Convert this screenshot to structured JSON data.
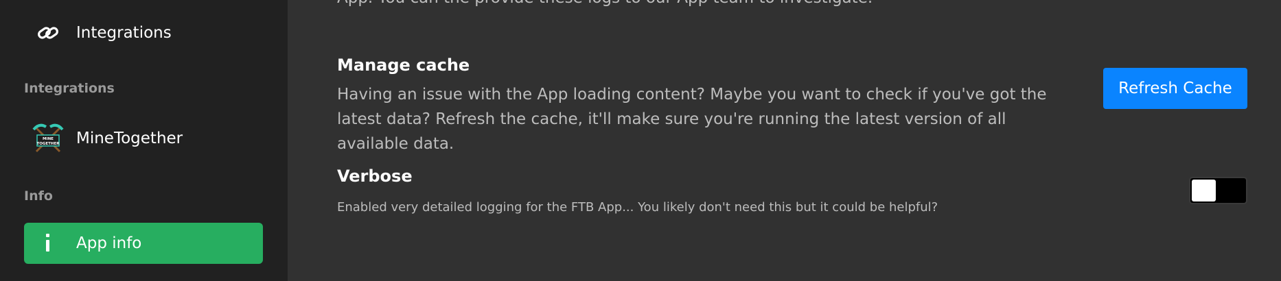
{
  "sidebar": {
    "items": [
      {
        "label": "Integrations",
        "icon": "link-icon"
      },
      {
        "label": "MineTogether",
        "icon": "minetogether-logo"
      },
      {
        "label": "App info",
        "icon": "info-icon",
        "active": true
      }
    ],
    "sections": [
      {
        "title": "Integrations"
      },
      {
        "title": "Info"
      }
    ],
    "minetogether_logo_text": "MINE TOGETHER"
  },
  "main": {
    "clipped_text": "App. You can the provide these logs to our App team to investigate.",
    "manage_cache": {
      "title": "Manage cache",
      "description": "Having an issue with the App loading content? Maybe you want to check if you've got the latest data? Refresh the cache, it'll make sure you're running the latest version of all available data.",
      "button_label": "Refresh Cache"
    },
    "verbose": {
      "title": "Verbose",
      "description": "Enabled very detailed logging for the FTB App... You likely don't need this but it could be helpful?",
      "enabled": false
    }
  },
  "colors": {
    "sidebar_bg": "#212121",
    "main_bg": "#313131",
    "active_green": "#27ae60",
    "button_blue": "#0a84ff",
    "muted_text": "#bdbdbd",
    "section_title": "#9a9a9a"
  }
}
